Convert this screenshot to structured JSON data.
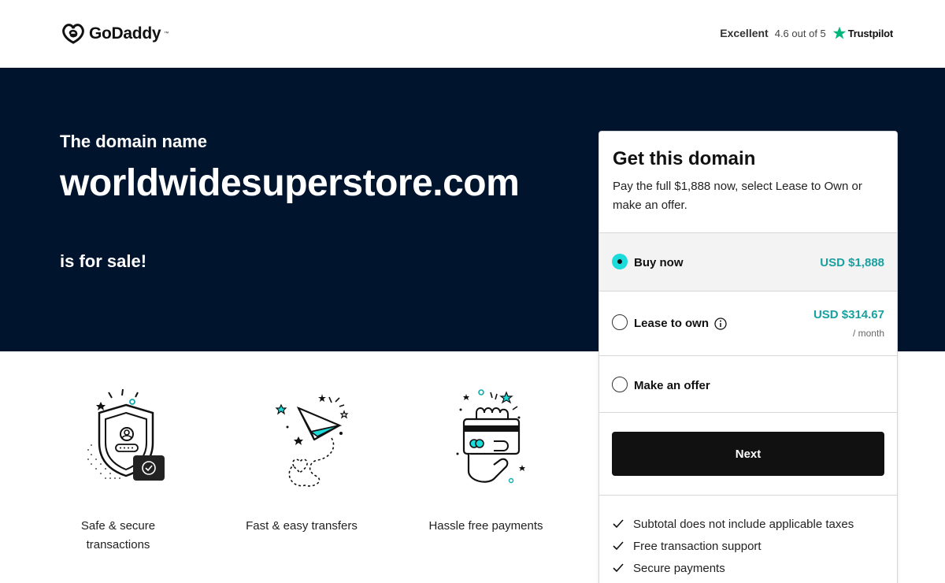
{
  "header": {
    "logo": "GoDaddy",
    "trust_excellent": "Excellent",
    "trust_rating": "4.6 out of 5",
    "trust_brand": "Trustpilot",
    "trust_star_color": "#00b67a"
  },
  "hero": {
    "pre": "The domain name",
    "domain": "worldwidesuperstore.com",
    "post": "is for sale!",
    "bg_color": "#00142d"
  },
  "features": [
    {
      "label": "Safe & secure transactions",
      "icon": "shield-icon"
    },
    {
      "label": "Fast & easy transfers",
      "icon": "paper-plane-icon"
    },
    {
      "label": "Hassle free payments",
      "icon": "payment-card-hand-icon"
    }
  ],
  "card": {
    "title": "Get this domain",
    "subtitle": "Pay the full $1,888 now, select Lease to Own or make an offer.",
    "options": [
      {
        "label": "Buy now",
        "price": "USD $1,888",
        "selected": true
      },
      {
        "label": "Lease to own",
        "price": "USD $314.67",
        "unit": "/ month",
        "selected": false
      },
      {
        "label": "Make an offer",
        "selected": false
      }
    ],
    "next_label": "Next",
    "bullets": [
      "Subtotal does not include applicable taxes",
      "Free transaction support",
      "Secure payments"
    ],
    "accent_color": "#1bdbdb",
    "price_color": "#19a0a0"
  }
}
